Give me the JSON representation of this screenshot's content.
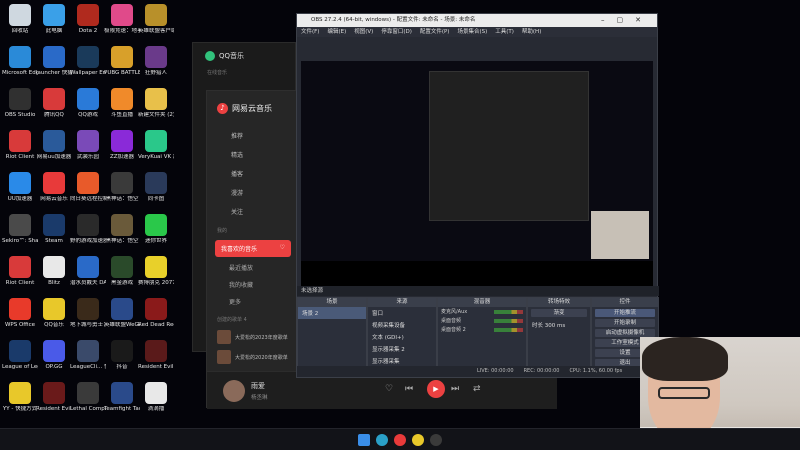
{
  "desktop": {
    "icons": [
      {
        "label": "回收站",
        "color": "#cfd8e0"
      },
      {
        "label": "此电脑",
        "color": "#3aa0e8"
      },
      {
        "label": "Dota 2",
        "color": "#b02a1e"
      },
      {
        "label": "极限竞速：地平线 5",
        "color": "#e04a8a"
      },
      {
        "label": "英雄联盟客户端",
        "color": "#b8902a"
      },
      {
        "label": "Microsoft Edge",
        "color": "#2a8ad8"
      },
      {
        "label": "launcher 快捷方式",
        "color": "#2a6ac8"
      },
      {
        "label": "Wallpaper Engine: ...",
        "color": "#1a3a5a"
      },
      {
        "label": "PUBG BATTLEGR...",
        "color": "#d8a02a"
      },
      {
        "label": "狂野猎人",
        "color": "#6a3a8a"
      },
      {
        "label": "OBS Studio",
        "color": "#303030"
      },
      {
        "label": "腾讯QQ",
        "color": "#d83a3a"
      },
      {
        "label": "QQ游戏",
        "color": "#2a7ad8"
      },
      {
        "label": "斗鱼直播",
        "color": "#f08a2a"
      },
      {
        "label": "新建文件夹 (2)",
        "color": "#e8c04a"
      },
      {
        "label": "Riot Client",
        "color": "#d83a3a"
      },
      {
        "label": "网易uu加速器",
        "color": "#2a5a9a"
      },
      {
        "label": "武装乐园",
        "color": "#7a4ab8"
      },
      {
        "label": "ZZ加速器",
        "color": "#8a2ad8"
      },
      {
        "label": "VeryKuai VK 加速器",
        "color": "#2ac88a"
      },
      {
        "label": "UU加速器",
        "color": "#2a8ae8"
      },
      {
        "label": "网易云音乐",
        "color": "#e83a3a"
      },
      {
        "label": "向日葵远程控制",
        "color": "#e85a2a"
      },
      {
        "label": "黑神话：悟空",
        "color": "#3a3a3a"
      },
      {
        "label": "同卡图",
        "color": "#2a3a5a"
      },
      {
        "label": "Sekiro™: Shadow...",
        "color": "#4a4a4a"
      },
      {
        "label": "Steam",
        "color": "#1a3a6a"
      },
      {
        "label": "野豹游戏加速器",
        "color": "#2a2a2a"
      },
      {
        "label": "黑神话：悟空",
        "color": "#6a5a3a"
      },
      {
        "label": "迷你世界",
        "color": "#2ac84a"
      },
      {
        "label": "Riot Client",
        "color": "#d83a3a"
      },
      {
        "label": "Blitz",
        "color": "#e8e8e8"
      },
      {
        "label": "潜水员戴夫 DAVE T...",
        "color": "#2a6ac8"
      },
      {
        "label": "黑金游戏",
        "color": "#2a4a2a"
      },
      {
        "label": "赛博朋克 2077",
        "color": "#e8d02a"
      },
      {
        "label": "WPS Office",
        "color": "#e83a2a"
      },
      {
        "label": "QQ音乐",
        "color": "#e8c82a"
      },
      {
        "label": "地下城与勇士：创新世纪",
        "color": "#3a2a1a"
      },
      {
        "label": "英雄联盟WeGame",
        "color": "#2a4a8a"
      },
      {
        "label": "Red Dead Redempti...",
        "color": "#8a1a1a"
      },
      {
        "label": "League of Legends",
        "color": "#1a3a6a"
      },
      {
        "label": "OP.GG",
        "color": "#4a5ae8"
      },
      {
        "label": "LeagueCli... 快捷方式",
        "color": "#3a4a6a"
      },
      {
        "label": "抖音",
        "color": "#1a1a1a"
      },
      {
        "label": "Resident Evil Re...",
        "color": "#5a1a1a"
      },
      {
        "label": "YY - 快捷方式",
        "color": "#e8c82a"
      },
      {
        "label": "Resident Evil 4",
        "color": "#6a1a1a"
      },
      {
        "label": "Lethal Company",
        "color": "#3a3a3a"
      },
      {
        "label": "Teamfight Tactics",
        "color": "#2a4a8a"
      },
      {
        "label": "滴滴播",
        "color": "#e8e8e8"
      }
    ]
  },
  "qqmusic": {
    "title": "QQ音乐",
    "section": "在线音乐"
  },
  "netease": {
    "title": "网易云音乐",
    "nav": [
      "推荐",
      "精选",
      "播客",
      "漫游",
      "关注"
    ],
    "section_mine": "我的",
    "liked": "我喜欢的音乐",
    "recent": "最近播放",
    "favorites": "我的收藏",
    "more": "更多",
    "created_header": "创建的歌单 4",
    "playlists": [
      "大爱松的2023年度歌单",
      "大爱松的2020年度歌单"
    ],
    "player": {
      "song": "雨爱",
      "artist": "杨丞琳"
    }
  },
  "obs": {
    "title": "OBS 27.2.4 (64-bit, windows) - 配置文件: 未命名 - 场景: 未命名",
    "menu": [
      "文件(F)",
      "编辑(E)",
      "视图(V)",
      "停靠窗口(D)",
      "配置文件(P)",
      "场景集合(S)",
      "工具(T)",
      "帮助(H)"
    ],
    "source_bar": "未选择源",
    "docks": {
      "scenes": {
        "title": "场景",
        "items": [
          "场景 2"
        ]
      },
      "sources": {
        "title": "来源",
        "items": [
          "窗口",
          "视频采集设备",
          "文本 (GDI+)",
          "显示器采集 2",
          "显示器采集"
        ]
      },
      "mixer": {
        "title": "混音器",
        "channels": [
          "麦克风/Aux",
          "桌面音频",
          "桌面音频 2"
        ]
      },
      "transitions": {
        "title": "转场特效",
        "type": "渐变",
        "duration_label": "时长",
        "duration": "300 ms"
      },
      "controls": {
        "title": "控件",
        "buttons": [
          "开始推流",
          "开始录制",
          "启动虚拟摄像机",
          "工作室模式",
          "设置",
          "退出"
        ]
      }
    },
    "status": {
      "live": "LIVE: 00:00:00",
      "rec": "REC: 00:00:00",
      "cpu": "CPU: 1.1%, 60.00 fps"
    }
  }
}
